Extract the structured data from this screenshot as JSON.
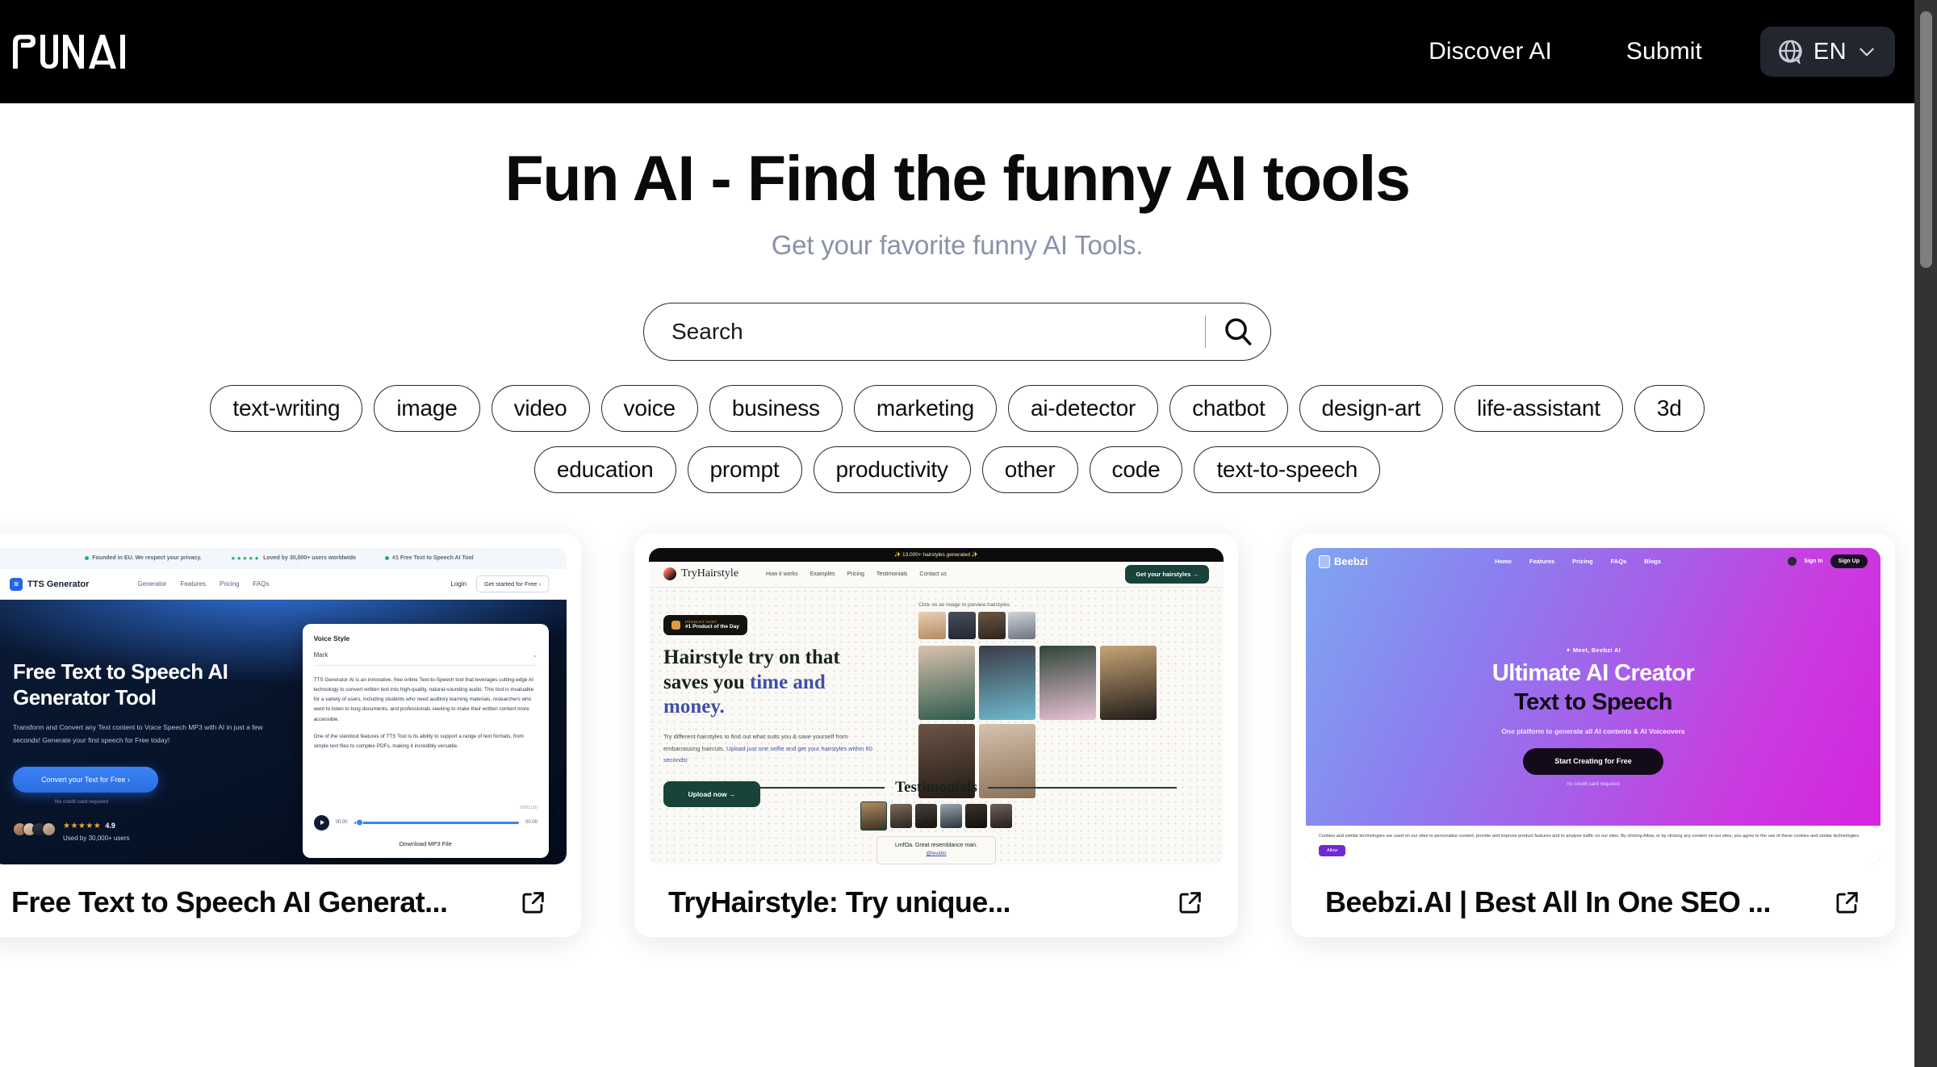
{
  "header": {
    "logo_text": "FUNAI",
    "nav": [
      {
        "label": "Discover AI"
      },
      {
        "label": "Submit"
      }
    ],
    "language": {
      "code": "EN",
      "globe_icon": "globe-speech-bubble-icon",
      "chevron_icon": "chevron-down-icon"
    }
  },
  "hero": {
    "title": "Fun AI - Find the funny AI tools",
    "subtitle": "Get your favorite funny AI Tools.",
    "subtitle_color": "#8b90ab"
  },
  "search": {
    "placeholder": "Search",
    "value": "",
    "icon": "search-icon"
  },
  "tags": [
    {
      "label": "text-writing"
    },
    {
      "label": "image"
    },
    {
      "label": "video"
    },
    {
      "label": "voice"
    },
    {
      "label": "business"
    },
    {
      "label": "marketing"
    },
    {
      "label": "ai-detector"
    },
    {
      "label": "chatbot"
    },
    {
      "label": "design-art"
    },
    {
      "label": "life-assistant"
    },
    {
      "label": "3d"
    },
    {
      "label": "education"
    },
    {
      "label": "prompt"
    },
    {
      "label": "productivity"
    },
    {
      "label": "other"
    },
    {
      "label": "code"
    },
    {
      "label": "text-to-speech"
    }
  ],
  "cards": [
    {
      "title": "Free Text to Speech AI Generat...",
      "link_icon": "external-link-icon",
      "thumb": {
        "kind": "tts-generator",
        "topbar": [
          "Founded in EU. We respect your privacy.",
          "Loved by 30,000+ users worldwide",
          "#1 Free Text to Speech AI Tool"
        ],
        "topbar_stars": "★★★★★",
        "brand": "TTS Generator",
        "nav": [
          "Generator",
          "Features",
          "Pricing",
          "FAQs"
        ],
        "login": "Login",
        "cta": "Get started for Free ›",
        "headline": "Free Text to Speech AI Generator Tool",
        "paragraph": "Transform and Convert any Text content to Voice Speech MP3 with AI in just a few seconds! Generate your first speech for Free today!",
        "button": "Convert your Text for Free  ›",
        "button_note": "No credit card required",
        "rating_stars": "★★★★★",
        "rating_value": "4.9",
        "rating_users": "Used by 30,000+ users",
        "panel_label": "Voice Style",
        "panel_select": "Mark",
        "panel_body_1": "TTS Generator AI is an innovative, free online Text-to-Speech tool that leverages cutting-edge AI technology to convert written text into high-quality, natural-sounding audio. This tool is invaluable for a variety of users, including students who need auditory learning materials, researchers who want to listen to long documents, and professionals seeking to make their written content more accessible.",
        "panel_body_2": "One of the standout features of TTS Tool is its ability to support a range of text formats, from simple text files to complex PDFs, making it incredibly versatile.",
        "panel_count": "109/1120",
        "time_start": "00:00",
        "time_end": "00:00",
        "download": "Download MP3 File"
      }
    },
    {
      "title": "TryHairstyle: Try unique...",
      "link_icon": "external-link-icon",
      "thumb": {
        "kind": "tryhairstyle",
        "banner": "✨ 13,000+ hairstyles generated ✨",
        "brand": "TryHairstyle",
        "nav": [
          "How it works",
          "Examples",
          "Pricing",
          "Testimonials",
          "Contact us"
        ],
        "cta": "Get your hairstyles →",
        "badge_small": "PRODUCT HUNT",
        "badge_main": "#1 Product of the Day",
        "headline_1": "Hairstyle try on that",
        "headline_2": "saves you ",
        "headline_2_accent": "time and",
        "headline_3": "money.",
        "paragraph": "Try different hairstyles to find out what suits you & save yourself from embarrassing haircuts. ",
        "paragraph_link": "Upload just one selfie and get your hairstyles within 60 seconds!",
        "upload_button": "Upload now  →",
        "grid_hint": "Click on an image to preview hairstyles:",
        "testimonials_title": "Testimonials",
        "quote_text": "LmfOa. Great resemblance man.",
        "quote_handle": "@levidio"
      }
    },
    {
      "title": "Beebzi.AI | Best All In One SEO ...",
      "link_icon": "external-link-icon",
      "thumb": {
        "kind": "beebzi",
        "brand": "Beebzi",
        "nav": [
          "Home",
          "Features",
          "Pricing",
          "FAQs",
          "Blogs"
        ],
        "signin": "Sign In",
        "signup": "Sign Up",
        "kicker": "✦ Meet, Beebzi AI",
        "headline_1": "Ultimate AI Creator",
        "headline_2": "Text to Speech",
        "subtitle": "One platform to generate all AI contents & AI Voiceovers",
        "button": "Start Creating for Free",
        "note": "no credit card required",
        "cookie_text": "Cookies and similar technologies are used on our sites to personalise content, provide and improve product features and to analyse traffic on our sites. By clicking Allow, or by clicking any content on our sites, you agree to the use of these cookies and similar technologies.",
        "cookie_button": "Allow"
      }
    }
  ],
  "scrollbar": {
    "track_color": "#333333",
    "thumb_color": "#7e7e7e"
  }
}
